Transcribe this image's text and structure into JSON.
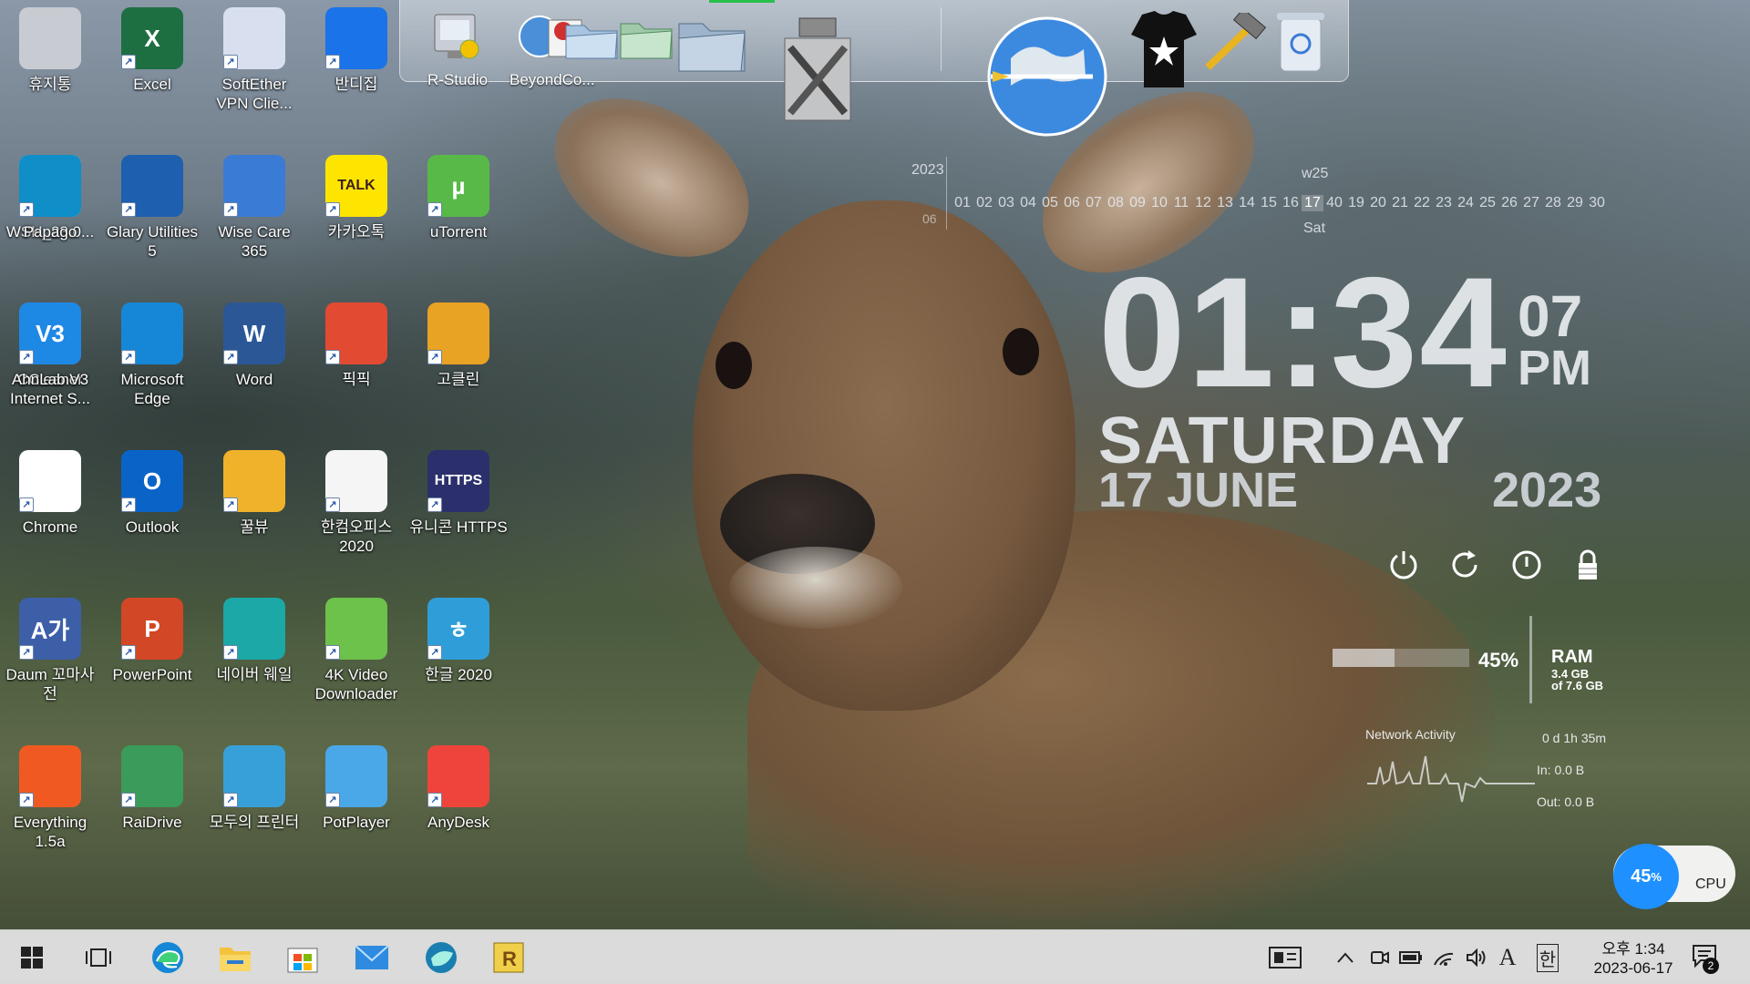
{
  "desktop_icons": [
    {
      "label": "휴지통",
      "icon": "recycle-bin-icon",
      "color": "#c8ccd2"
    },
    {
      "label": "Excel",
      "icon": "excel-icon",
      "color": "#1d6f42",
      "glyph": "X"
    },
    {
      "label": "SoftEther VPN Clie...",
      "icon": "softether-vpn-icon",
      "color": "#d8e0f0"
    },
    {
      "label": "반디집",
      "icon": "bandizip-icon",
      "color": "#1a73e8"
    },
    {
      "label": "WSH_23.0...",
      "icon": "wsh-disc-icon",
      "color": "#e8e8e8"
    },
    {
      "label": "Glary Utilities 5",
      "icon": "glary-utilities-icon",
      "color": "#1e5fb0"
    },
    {
      "label": "Wise Care 365",
      "icon": "wise-care-icon",
      "color": "#3a7bd5"
    },
    {
      "label": "카카오톡",
      "icon": "kakaotalk-icon",
      "color": "#fee500",
      "glyph": "TALK"
    },
    {
      "label": "uTorrent",
      "icon": "utorrent-icon",
      "color": "#58b948",
      "glyph": "µ"
    },
    {
      "label": "Papago",
      "icon": "papago-icon",
      "color": "#0f8ec7"
    },
    {
      "label": "CCleaner",
      "icon": "ccleaner-icon",
      "color": "#e23b2e",
      "glyph": "C"
    },
    {
      "label": "Microsoft Edge",
      "icon": "edge-icon",
      "color": "#1587d6"
    },
    {
      "label": "Word",
      "icon": "word-icon",
      "color": "#2b5797",
      "glyph": "W"
    },
    {
      "label": "픽픽",
      "icon": "picpick-icon",
      "color": "#e24a32"
    },
    {
      "label": "고클린",
      "icon": "goclean-icon",
      "color": "#e8a224"
    },
    {
      "label": "AhnLab V3 Internet S...",
      "icon": "ahnlab-v3-icon",
      "color": "#1e88e5",
      "glyph": "V3"
    },
    {
      "label": "Chrome",
      "icon": "chrome-icon",
      "color": "#ffffff"
    },
    {
      "label": "Outlook",
      "icon": "outlook-icon",
      "color": "#0a64c8",
      "glyph": "O"
    },
    {
      "label": "꿀뷰",
      "icon": "honeyview-icon",
      "color": "#f0b22a"
    },
    {
      "label": "한컴오피스 2020",
      "icon": "hancom-office-icon",
      "color": "#f5f5f5"
    },
    {
      "label": "유니콘 HTTPS",
      "icon": "unicorn-https-icon",
      "color": "#2b2f6c",
      "glyph": "HTTPS"
    },
    {
      "label": "Daum 꼬마사전",
      "icon": "daum-dictionary-icon",
      "color": "#3d5fa8",
      "glyph": "A가"
    },
    {
      "label": "PowerPoint",
      "icon": "powerpoint-icon",
      "color": "#d24726",
      "glyph": "P"
    },
    {
      "label": "네이버 웨일",
      "icon": "naver-whale-icon",
      "color": "#1ba8a6"
    },
    {
      "label": "4K Video Downloader",
      "icon": "4k-video-downloader-icon",
      "color": "#6cc24a"
    },
    {
      "label": "한글 2020",
      "icon": "hangul-2020-icon",
      "color": "#2f9ed8",
      "glyph": "ㅎ"
    },
    {
      "label": "Everything 1.5a",
      "icon": "everything-search-icon",
      "color": "#f05a22"
    },
    {
      "label": "RaiDrive",
      "icon": "raidrive-icon",
      "color": "#3a9b5a"
    },
    {
      "label": "모두의 프린터",
      "icon": "printer-icon",
      "color": "#38a0d8"
    },
    {
      "label": "PotPlayer",
      "icon": "potplayer-icon",
      "color": "#4aa8e8"
    },
    {
      "label": "AnyDesk",
      "icon": "anydesk-icon",
      "color": "#ef443b"
    }
  ],
  "dock": {
    "items": [
      {
        "label": "R-Studio",
        "icon": "r-studio-icon"
      },
      {
        "label": "BeyondCo...",
        "icon": "beyond-compare-icon"
      },
      {
        "label": "",
        "icon": "folder-icon"
      },
      {
        "label": "",
        "icon": "folder-icon"
      },
      {
        "label": "",
        "icon": "folder-icon"
      },
      {
        "label": "",
        "icon": "tools-icon"
      },
      {
        "label": "",
        "icon": "globe-icon"
      },
      {
        "label": "",
        "icon": "tshirt-icon"
      },
      {
        "label": "",
        "icon": "hammer-icon"
      },
      {
        "label": "",
        "icon": "recycle-bin-icon"
      }
    ]
  },
  "calendar": {
    "year": "2023",
    "month_num": "06",
    "week": "w25",
    "days": [
      "01",
      "02",
      "03",
      "04",
      "05",
      "06",
      "07",
      "08",
      "09",
      "10",
      "11",
      "12",
      "13",
      "14",
      "15",
      "16",
      "17",
      "40",
      "19",
      "20",
      "21",
      "22",
      "23",
      "24",
      "25",
      "26",
      "27",
      "28",
      "29",
      "30"
    ],
    "today_index": 16,
    "dow": "Sat"
  },
  "clock": {
    "time": "01:34",
    "seconds": "07",
    "ampm": "PM",
    "day": "SATURDAY",
    "date": "17 JUNE",
    "year": "2023"
  },
  "power_buttons": [
    "power-icon",
    "restart-icon",
    "logoff-icon",
    "lock-icon"
  ],
  "ram": {
    "percent": "45%",
    "fraction": 0.45,
    "label": "RAM",
    "used": "3.4 GB",
    "total": "of 7.6 GB"
  },
  "network": {
    "title": "Network Activity",
    "uptime": "0 d 1h 35m",
    "in": "In: 0.0 B",
    "out": "Out: 0.0 B"
  },
  "cpu": {
    "percent": "45",
    "unit": "%",
    "label": "CPU"
  },
  "taskbar": {
    "pinned": [
      "windows-start-icon",
      "task-view-icon",
      "edge-icon",
      "file-explorer-icon",
      "microsoft-store-icon",
      "mail-icon",
      "naver-whale-icon",
      "r-app-icon"
    ],
    "tray": [
      "news-widget-icon",
      "chevron-up-icon",
      "meet-now-icon",
      "battery-icon",
      "wifi-icon",
      "volume-icon",
      "ime-a-icon",
      "ime-han-icon"
    ],
    "time": "오후 1:34",
    "date": "2023-06-17",
    "ime_a": "A",
    "ime_han": "한",
    "notifications": "2"
  }
}
